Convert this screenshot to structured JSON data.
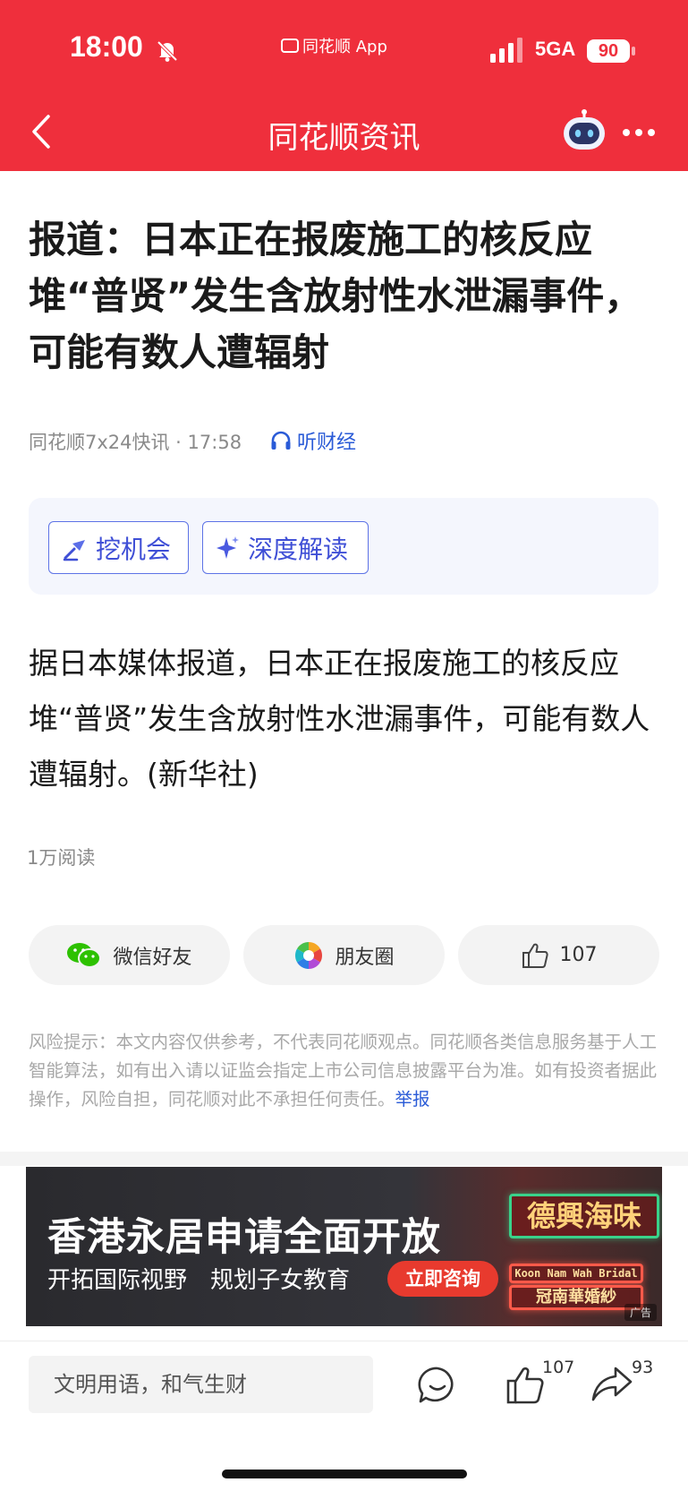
{
  "status_bar": {
    "time": "18:00",
    "app_source": "同花顺 App",
    "network": "5GA",
    "battery": "90"
  },
  "nav": {
    "title": "同花顺资讯"
  },
  "article": {
    "headline": "报道：日本正在报废施工的核反应堆“普贤”发生含放射性水泄漏事件，可能有数人遭辐射",
    "source_time": "同花顺7x24快讯 · 17:58",
    "listen_label": "听财经",
    "ai_actions": [
      "挖机会",
      "深度解读"
    ],
    "body": "据日本媒体报道，日本正在报废施工的核反应堆“普贤”发生含放射性水泄漏事件，可能有数人遭辐射。(新华社)",
    "reads": "1万阅读"
  },
  "share": {
    "wechat_label": "微信好友",
    "moments_label": "朋友圈",
    "like_count": "107"
  },
  "disclaimer": {
    "text": "风险提示：本文内容仅供参考，不代表同花顺观点。同花顺各类信息服务基于人工智能算法，如有出入请以证监会指定上市公司信息披露平台为准。如有投资者据此操作，风险自担，同花顺对此不承担任何责任。",
    "report_label": "举报"
  },
  "ad": {
    "title": "香港永居申请全面开放",
    "subtitle": "开拓国际视野　规划子女教育",
    "cta": "立即咨询",
    "sign_1": "德興海味",
    "sign_2": "Koon Nam Wah Bridal",
    "sign_3": "冠南華婚紗",
    "badge": "广告"
  },
  "bottom_bar": {
    "comment_placeholder": "文明用语，和气生财",
    "like_count": "107",
    "share_count": "93"
  },
  "colors": {
    "brand_red": "#ef2f3c",
    "link_blue": "#2a5bd7",
    "ai_purple": "#3f4fd6"
  }
}
